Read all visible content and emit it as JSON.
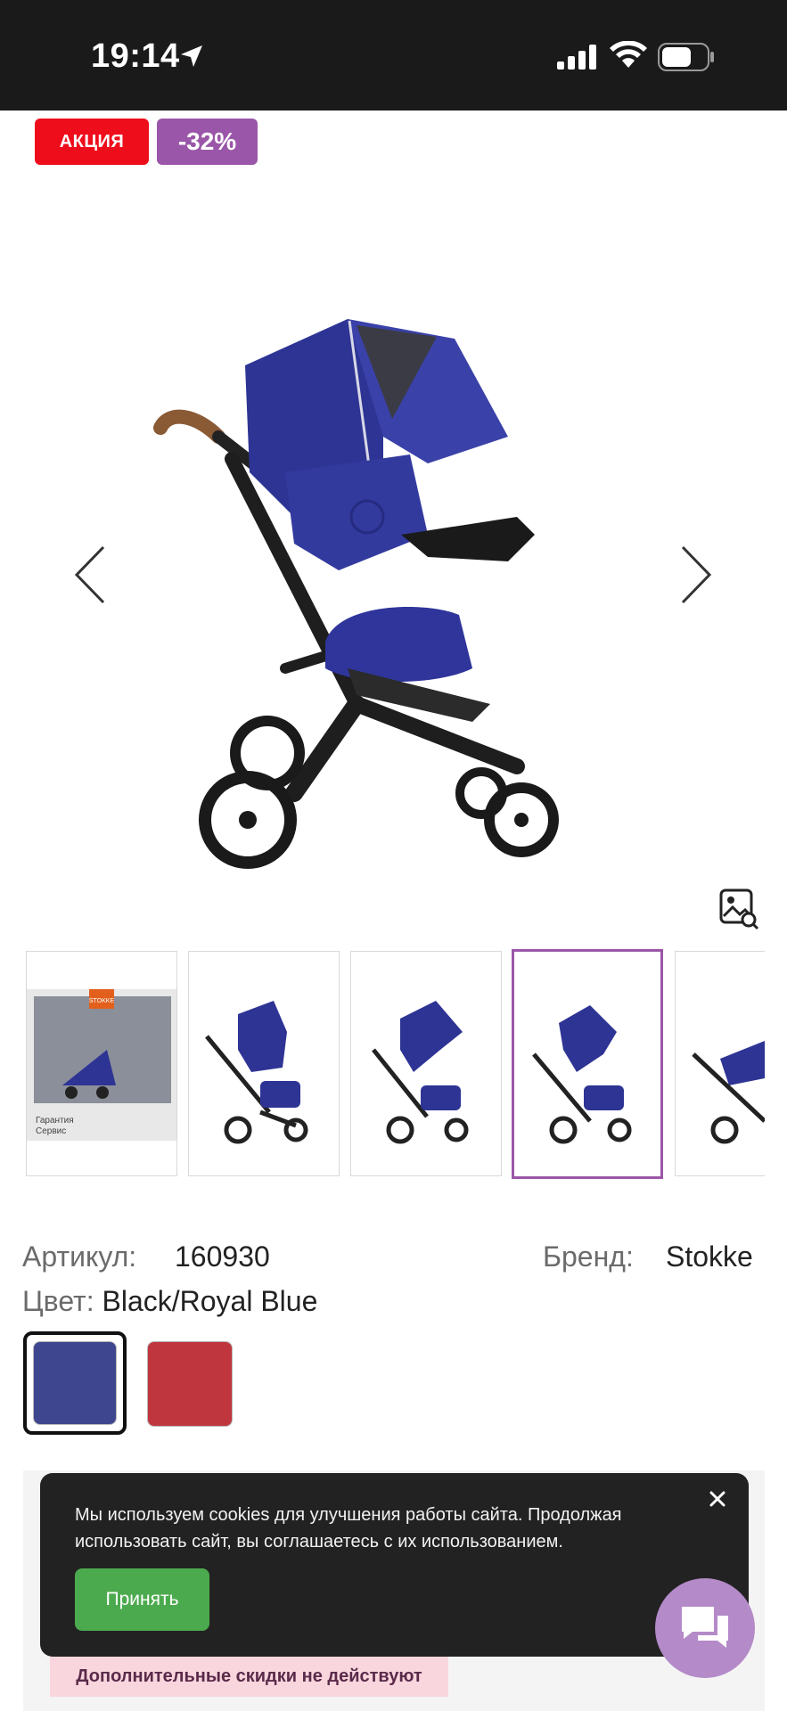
{
  "status_bar": {
    "time": "19:14",
    "icons": [
      "location-arrow-icon",
      "signal-icon",
      "wifi-icon",
      "battery-icon"
    ]
  },
  "badges": {
    "sale": "АКЦИЯ",
    "discount": "-32%"
  },
  "gallery": {
    "main_image": "stroller-royal-blue",
    "thumbnail_count_visible": 5,
    "selected_thumbnail": 4,
    "thumb1_caption_line1": "Гарантия",
    "thumb1_caption_line2": "Сервис",
    "thumb1_logo": "STOKKE"
  },
  "product": {
    "article_label": "Артикул:",
    "article_value": "160930",
    "brand_label": "Бренд:",
    "brand_value": "Stokke",
    "color_label": "Цвет:",
    "color_value": "Black/Royal Blue",
    "colors": [
      {
        "name": "royal-blue",
        "hex": "#3e468f",
        "selected": true
      },
      {
        "name": "red",
        "hex": "#c0363f",
        "selected": false
      }
    ]
  },
  "cookie_banner": {
    "text": "Мы используем cookies для улучшения работы сайта. Продолжая использовать сайт, вы соглашаетесь с их использованием.",
    "accept_label": "Принять"
  },
  "notice": {
    "no_discount": "Дополнительные скидки не действуют"
  },
  "colors": {
    "status_bar_bg": "#1a1a1a",
    "sale_badge": "#ee0d1b",
    "discount_badge": "#9a56a8",
    "accent_purple": "#9a56a8",
    "accept_green": "#4caa4e",
    "chat_purple": "#b48ac8"
  }
}
